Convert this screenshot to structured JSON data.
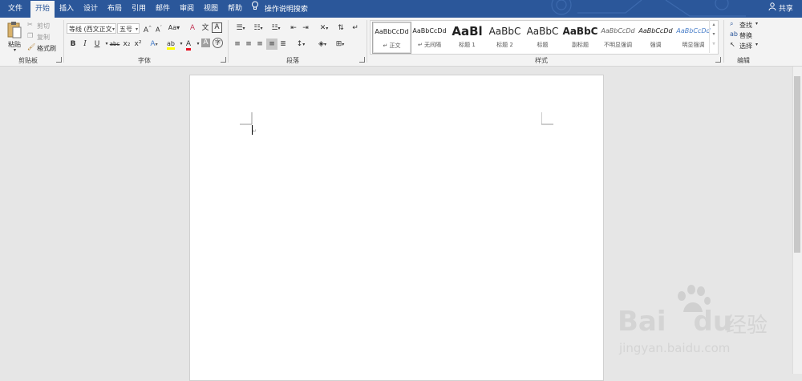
{
  "tabs": [
    {
      "label": "文件"
    },
    {
      "label": "开始"
    },
    {
      "label": "插入"
    },
    {
      "label": "设计"
    },
    {
      "label": "布局"
    },
    {
      "label": "引用"
    },
    {
      "label": "邮件"
    },
    {
      "label": "审阅"
    },
    {
      "label": "视图"
    },
    {
      "label": "帮助"
    }
  ],
  "tell_me": "操作说明搜索",
  "share": "共享",
  "clipboard": {
    "paste": "粘贴",
    "cut": "剪切",
    "copy": "复制",
    "format_painter": "格式刷",
    "group": "剪贴板"
  },
  "font": {
    "name": "等线 (西文正文",
    "size": "五号",
    "group": "字体",
    "grow": "A",
    "shrink": "A",
    "case": "Aa",
    "clear": "A",
    "phonetic": "文",
    "border": "A",
    "bold": "B",
    "italic": "I",
    "underline": "U",
    "strike": "abc",
    "sub": "x₂",
    "sup": "x²",
    "effects": "A",
    "highlight": "ab",
    "color": "A",
    "shade": "A",
    "enclose": "字"
  },
  "paragraph": {
    "group": "段落"
  },
  "styles": {
    "group": "样式",
    "items": [
      {
        "preview": "AaBbCcDd",
        "name": "正文"
      },
      {
        "preview": "AaBbCcDd",
        "name": "无间隔"
      },
      {
        "preview": "AaBl",
        "name": "标题 1"
      },
      {
        "preview": "AaBbC",
        "name": "标题 2"
      },
      {
        "preview": "AaBbC",
        "name": "标题"
      },
      {
        "preview": "AaBbC",
        "name": "副标题"
      },
      {
        "preview": "AaBbCcDd",
        "name": "不明显强调"
      },
      {
        "preview": "AaBbCcDd",
        "name": "强调"
      },
      {
        "preview": "AaBbCcDd",
        "name": "明显强调"
      }
    ]
  },
  "editing": {
    "find": "查找",
    "replace": "替换",
    "select": "选择",
    "group": "编辑"
  },
  "watermark": {
    "brand": "Bai",
    "brand2": "du",
    "cn": "经验",
    "url": "jingyan.baidu.com"
  },
  "colors": {
    "accent": "#2b579a",
    "highlight": "#ffff00",
    "font_color": "#e81123"
  }
}
